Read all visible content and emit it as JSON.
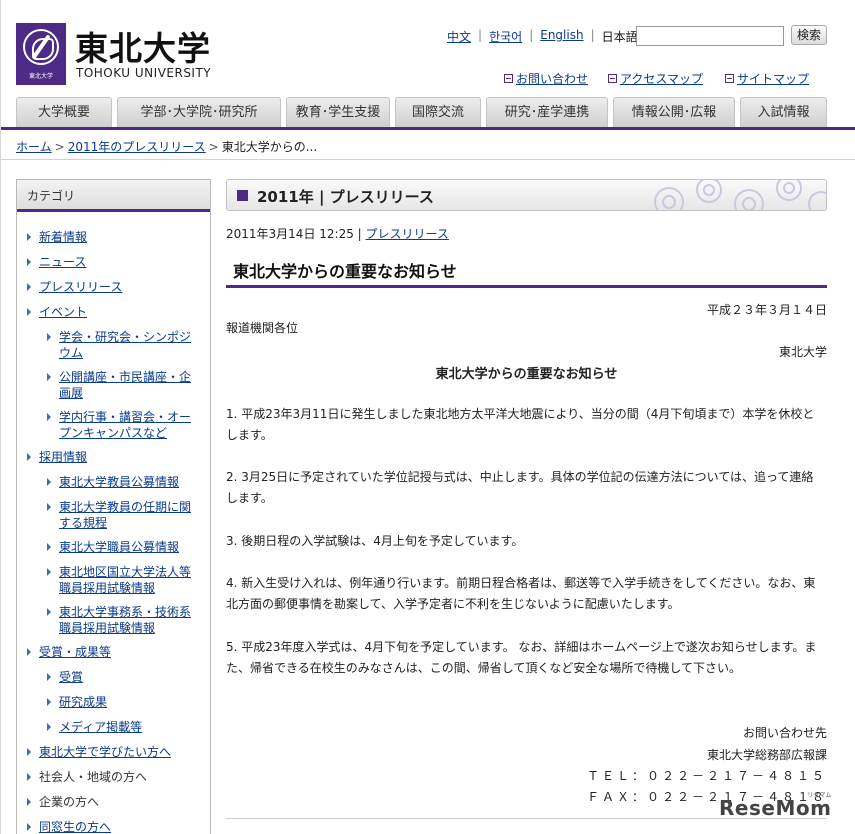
{
  "header": {
    "logo_caption": "東北大学",
    "name_ja": "東北大学",
    "name_en": "TOHOKU UNIVERSITY",
    "langs": [
      "中文",
      "한국어",
      "English",
      "日本語"
    ],
    "search_button": "検索",
    "search_value": "",
    "util_links": [
      "お問い合わせ",
      "アクセスマップ",
      "サイトマップ"
    ]
  },
  "nav": [
    "大学概要",
    "学部･大学院･研究所",
    "教育･学生支援",
    "国際交流",
    "研究･産学連携",
    "情報公開･広報",
    "入試情報"
  ],
  "breadcrumb": [
    "ホーム",
    "2011年のプレスリリース",
    "東北大学からの..."
  ],
  "sidebar": {
    "title": "カテゴリ",
    "items": [
      "新着情報",
      "ニュース",
      "プレスリリース",
      "イベント",
      "学会・研究会・シンポジウム",
      "公開講座・市民講座・企画展",
      "学内行事・講習会・オープンキャンパスなど",
      "採用情報",
      "東北大学教員公募情報",
      "東北大学教員の任期に関する規程",
      "東北大学職員公募情報",
      "東北地区国立大学法人等職員採用試験情報",
      "東北大学事務系・技術系職員採用試験情報",
      "受賞・成果等",
      "受賞",
      "研究成果",
      "メディア掲載等",
      "東北大学で学びたい方へ",
      "社会人・地域の方へ",
      "企業の方へ",
      "同窓生の方へ"
    ]
  },
  "main": {
    "section_title": "2011年 | プレスリリース",
    "date": "2011年3月14日 12:25 |",
    "category_link": "プレスリリース",
    "title": "東北大学からの重要なお知らせ",
    "letter_date": "平成２３年３月１４日",
    "addressee": "報道機関各位",
    "sender": "東北大学",
    "letter_title": "東北大学からの重要なお知らせ",
    "p1a": "1. 平成23年3月11日に発生しました東北地方太平洋大地震により、当分の間（4月下旬頃まで）本学を休校と",
    "p1b": "します。",
    "p2a": "2. 3月25日に予定されていた学位記授与式は、中止します。具体の学位記の伝達方法については、追って連絡",
    "p2b": "します。",
    "p3": "3. 後期日程の入学試験は、4月上旬を予定しています。",
    "p4a": "4. 新入生受け入れは、例年通り行います。前期日程合格者は、郵送等で入学手続きをしてください。なお、東",
    "p4b": "北方面の郵便事情を勘案して、入学予定者に不利を生じないように配慮いたします。",
    "p5a": "5. 平成23年度入学式は、4月下旬を予定しています。 なお、詳細はホームページ上で遂次お知らせします。ま",
    "p5b": "た、帰省できる在校生のみなさんは、この間、帰省して頂くなど安全な場所で待機して下さい。",
    "contact_label": "お問い合わせ先",
    "contact_dept": "東北大学総務部広報課",
    "tel": "ＴＥＬ：０２２－２１７－４８１５",
    "fax": "ＦＡＸ：０２２－２１７－４８１８"
  },
  "watermark": {
    "a": "Rese",
    "b": "Mom",
    "small": "リセマム"
  }
}
